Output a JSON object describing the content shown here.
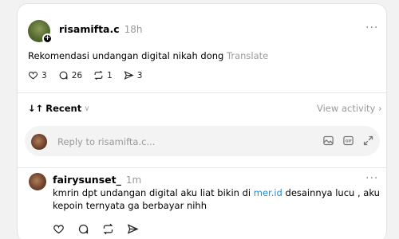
{
  "post": {
    "username": "risamifta.c",
    "time": "18h",
    "text": "Rekomendasi undangan digital nikah dong",
    "translate": "Translate",
    "likes": "3",
    "comments": "26",
    "reposts": "1",
    "shares": "3"
  },
  "sort": {
    "label": "Recent",
    "view_activity": "View activity"
  },
  "reply": {
    "placeholder": "Reply to risamifta.c..."
  },
  "comment": {
    "username": "fairysunset_",
    "time": "1m",
    "text_before": "kmrin dpt undangan digital aku liat bikin di ",
    "link": "mer.id",
    "text_after": " desainnya lucu , aku kepoin ternyata ga berbayar nihh"
  },
  "icons": {
    "more": "more-horizontal-icon",
    "heart": "heart-icon",
    "comment": "comment-icon",
    "repost": "repost-icon",
    "share": "share-icon",
    "image": "image-icon",
    "gif": "gif-icon",
    "expand": "expand-icon"
  },
  "colors": {
    "link": "#1d8bd8",
    "muted": "#999999"
  }
}
